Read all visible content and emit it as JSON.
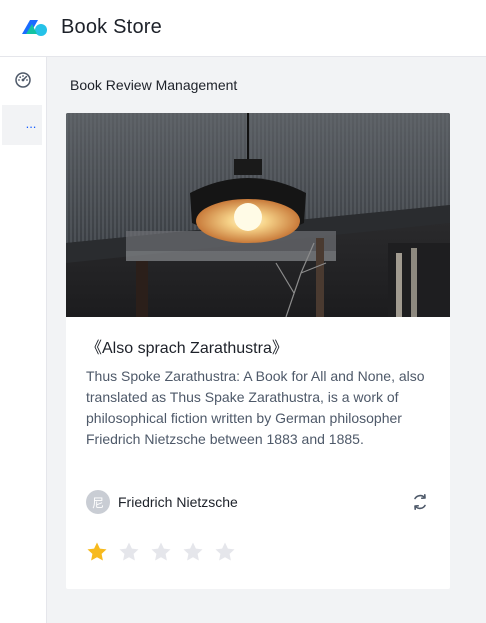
{
  "app": {
    "title": "Book Store",
    "logo_icon": "book-store-logo"
  },
  "sidebar": {
    "items": [
      {
        "icon": "dashboard-icon",
        "active": false
      },
      {
        "label": "...",
        "active": true
      }
    ]
  },
  "breadcrumb": "Book Review Management",
  "book": {
    "title": "《Also sprach Zarathustra》",
    "description": "Thus Spoke Zarathustra: A Book for All and None, also translated as Thus Spake Zarathustra, is a work of philosophical fiction written by German philosopher Friedrich Nietzsche between 1883 and 1885.",
    "author": "Friedrich Nietzsche",
    "avatar_char": "尼",
    "rating": 1,
    "max_rating": 5,
    "cover_icon": "pendant-lamp-photo"
  },
  "colors": {
    "accent": "#165dff",
    "star_on": "#f7ba1e",
    "star_off": "#e5e6eb",
    "background": "#f2f3f5"
  }
}
